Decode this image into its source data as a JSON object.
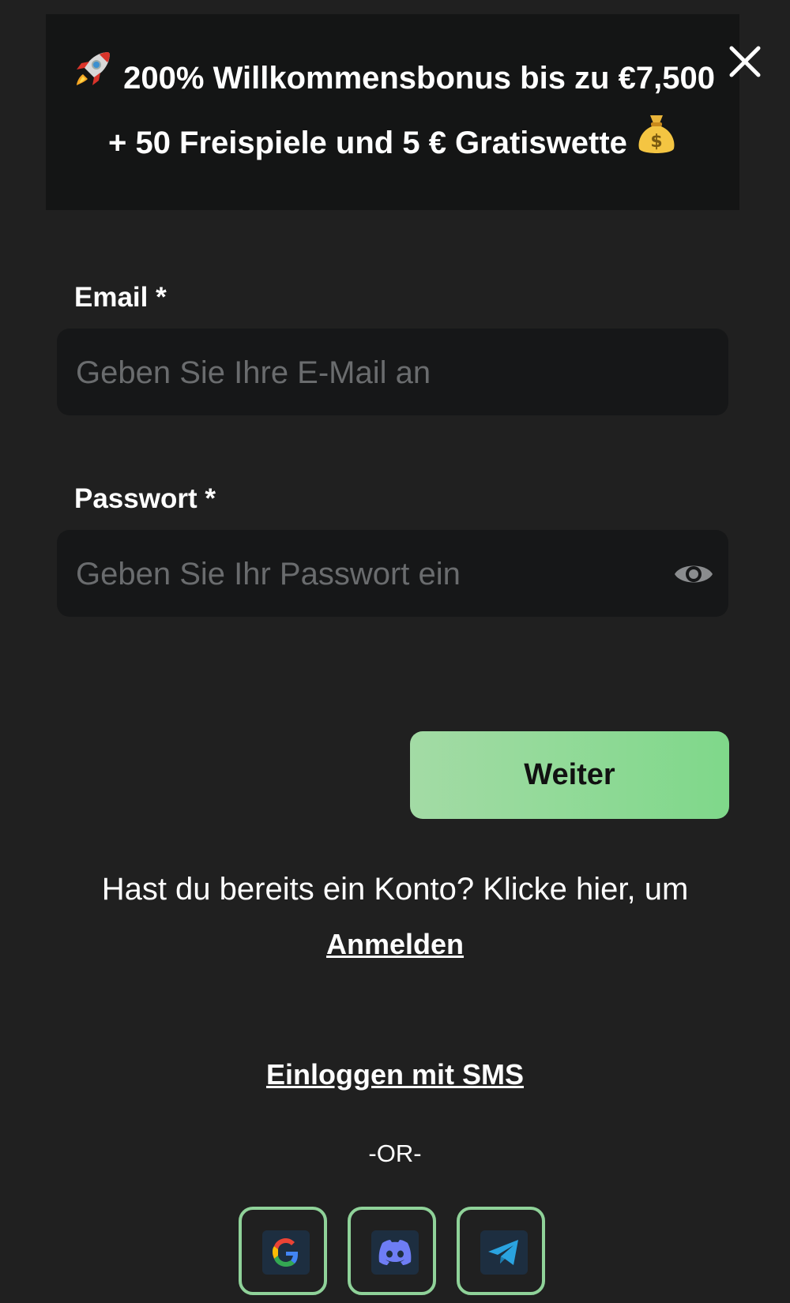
{
  "banner": {
    "line1": "200% Willkommensbonus bis zu €7,500",
    "line2": "+ 50 Freispiele und 5 € Gratiswette",
    "left_icon": "rocket-icon",
    "right_icon": "money-bag-icon"
  },
  "close": {
    "icon": "close-icon"
  },
  "email": {
    "label": "Email *",
    "placeholder": "Geben Sie Ihre E-Mail an",
    "value": ""
  },
  "password": {
    "label": "Passwort *",
    "placeholder": "Geben Sie Ihr Passwort ein",
    "value": "",
    "toggle_icon": "eye-icon"
  },
  "submit": {
    "label": "Weiter"
  },
  "account": {
    "text": "Hast du bereits ein Konto? Klicke hier, um",
    "login_link": "Anmelden"
  },
  "sms": {
    "label": "Einloggen mit SMS"
  },
  "divider": {
    "text": "-OR-"
  },
  "social": [
    {
      "provider": "google",
      "icon": "google-icon"
    },
    {
      "provider": "discord",
      "icon": "discord-icon"
    },
    {
      "provider": "telegram",
      "icon": "telegram-icon"
    }
  ],
  "colors": {
    "background": "#202020",
    "banner_bg": "#141515",
    "input_bg": "#161718",
    "accent_green": "#8fd299",
    "placeholder": "#6a6c6e"
  }
}
